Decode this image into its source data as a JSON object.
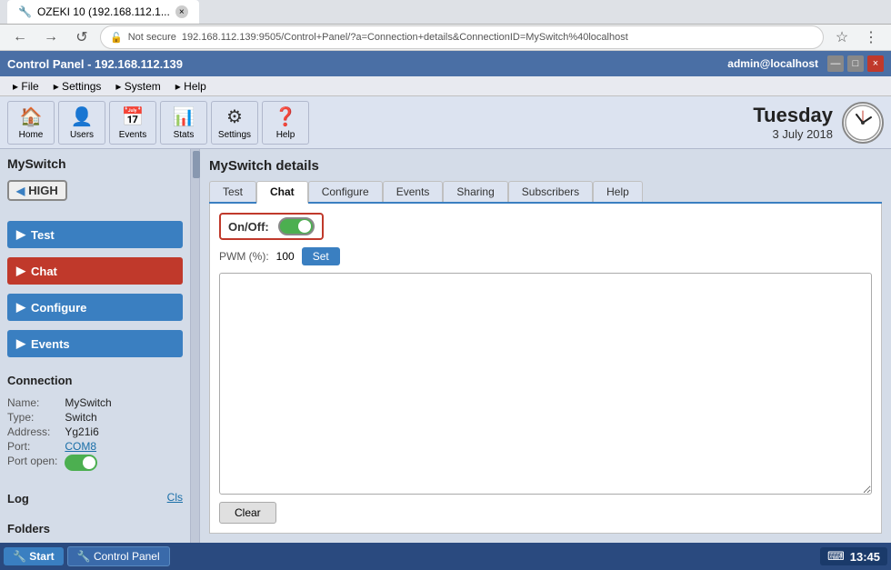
{
  "browser": {
    "tab_title": "OZEKI 10 (192.168.112.1...",
    "tab_favicon": "🔧",
    "protocol": "Not secure",
    "url": "192.168.112.139:9505/Control+Panel/?a=Connection+details&ConnectionID=MySwitch%40localhost",
    "back_btn": "←",
    "forward_btn": "→",
    "refresh_btn": "↺",
    "close_btn": "×"
  },
  "app": {
    "title": "Control Panel - 192.168.112.139",
    "user": "admin@localhost",
    "min_btn": "—",
    "max_btn": "□",
    "close_btn": "×"
  },
  "menu": {
    "items": [
      "File",
      "Settings",
      "System",
      "Help"
    ]
  },
  "toolbar": {
    "buttons": [
      {
        "icon": "🏠",
        "label": "Home"
      },
      {
        "icon": "👤",
        "label": "Users"
      },
      {
        "icon": "📅",
        "label": "Events"
      },
      {
        "icon": "📊",
        "label": "Stats"
      },
      {
        "icon": "⚙",
        "label": "Settings"
      },
      {
        "icon": "❓",
        "label": "Help"
      }
    ]
  },
  "clock": {
    "day": "Tuesday",
    "date": "3 July 2018"
  },
  "left_panel": {
    "switch_name": "MySwitch",
    "indicator_label": "HIGH",
    "buttons": [
      {
        "label": "Test",
        "type": "blue"
      },
      {
        "label": "Chat",
        "type": "red"
      },
      {
        "label": "Configure",
        "type": "blue"
      },
      {
        "label": "Events",
        "type": "blue"
      }
    ],
    "connection": {
      "title": "Connection",
      "fields": [
        {
          "label": "Name:",
          "value": "MySwitch",
          "link": false
        },
        {
          "label": "Type:",
          "value": "Switch",
          "link": false
        },
        {
          "label": "Address:",
          "value": "Yg21i6",
          "link": false
        },
        {
          "label": "Port:",
          "value": "COM8",
          "link": true
        },
        {
          "label": "Port open:",
          "value": "",
          "link": false,
          "toggle": true
        }
      ]
    },
    "log_title": "Log",
    "log_clear": "Cls",
    "folders_title": "Folders"
  },
  "right_panel": {
    "detail_title": "MySwitch details",
    "tabs": [
      "Test",
      "Chat",
      "Configure",
      "Events",
      "Sharing",
      "Subscribers",
      "Help"
    ],
    "active_tab": "Chat",
    "on_off_label": "On/Off:",
    "toggle_state": "on",
    "pwm_label": "PWM (%):",
    "pwm_value": "100",
    "set_btn": "Set",
    "clear_btn": "Clear"
  },
  "taskbar": {
    "start_label": "Start",
    "app_label": "Control Panel",
    "time": "13:45",
    "keyboard_icon": "⌨"
  }
}
